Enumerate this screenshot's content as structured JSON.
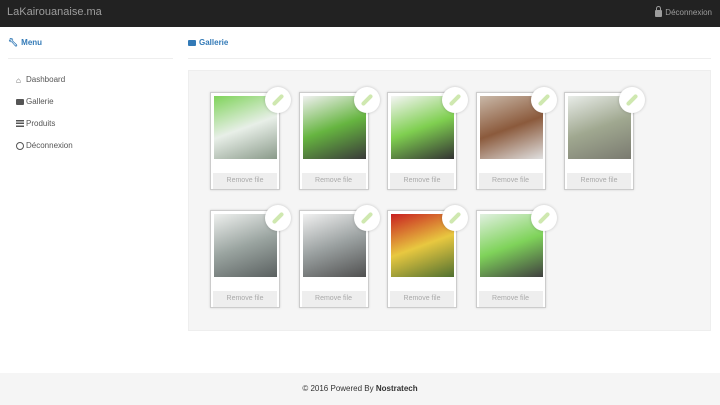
{
  "header": {
    "brand": "LaKairouanaise.ma",
    "logout": "Déconnexion"
  },
  "sidebar": {
    "title": "Menu",
    "items": [
      {
        "label": "Dashboard",
        "icon": "home-icon"
      },
      {
        "label": "Gallerie",
        "icon": "camera-icon"
      },
      {
        "label": "Produits",
        "icon": "list-icon"
      },
      {
        "label": "Déconnexion",
        "icon": "power-icon"
      }
    ]
  },
  "main": {
    "title": "Gallerie",
    "remove_label": "Remove file",
    "images": [
      {
        "colors": [
          "#7fd35a",
          "#e8efe8",
          "#8a9a8a"
        ]
      },
      {
        "colors": [
          "#f0f0f0",
          "#66b540",
          "#3a3a3a"
        ]
      },
      {
        "colors": [
          "#f5f5f5",
          "#7fcf50",
          "#333333"
        ]
      },
      {
        "colors": [
          "#c9b8a8",
          "#8b5a3c",
          "#e0e0e0"
        ]
      },
      {
        "colors": [
          "#e8ece8",
          "#a0a890",
          "#7a7a70"
        ]
      },
      {
        "colors": [
          "#eef0ee",
          "#9aa4a0",
          "#5a6060"
        ]
      },
      {
        "colors": [
          "#f0f0f0",
          "#9aa0a0",
          "#505050"
        ]
      },
      {
        "colors": [
          "#c82020",
          "#e8c840",
          "#507030"
        ]
      },
      {
        "colors": [
          "#e0f0e0",
          "#7fd35a",
          "#404040"
        ]
      }
    ]
  },
  "footer": {
    "prefix": "© 2016 Powered By ",
    "company": "Nostratech"
  }
}
